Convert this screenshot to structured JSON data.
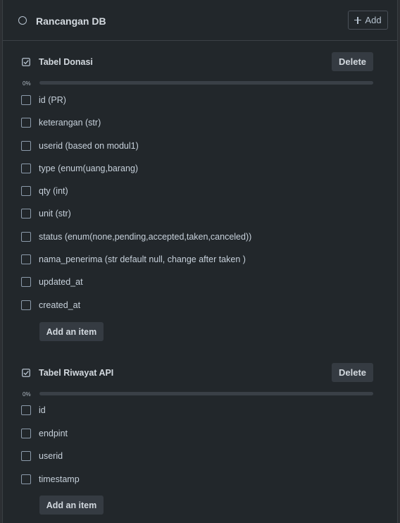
{
  "card": {
    "title": "Rancangan DB",
    "add_label": "Add"
  },
  "checklists": [
    {
      "title": "Tabel Donasi",
      "delete_label": "Delete",
      "progress": "0%",
      "progress_value": 0,
      "items": [
        "id (PR)",
        "keterangan (str)",
        "userid (based on modul1)",
        "type (enum(uang,barang)",
        "qty (int)",
        "unit (str)",
        "status (enum(none,pending,accepted,taken,canceled))",
        "nama_penerima (str default null, change after taken )",
        "updated_at",
        "created_at"
      ],
      "add_item_label": "Add an item"
    },
    {
      "title": "Tabel Riwayat API",
      "delete_label": "Delete",
      "progress": "0%",
      "progress_value": 0,
      "items": [
        "id",
        "endpint",
        "userid",
        "timestamp"
      ],
      "add_item_label": "Add an item"
    }
  ],
  "icons": {
    "header": "circle-icon",
    "checklist": "checklist-icon",
    "add": "plus-icon"
  },
  "colors": {
    "background": "#22272b",
    "text": "#c7d1db",
    "button": "#353b42",
    "progress_track": "#3a4047"
  }
}
